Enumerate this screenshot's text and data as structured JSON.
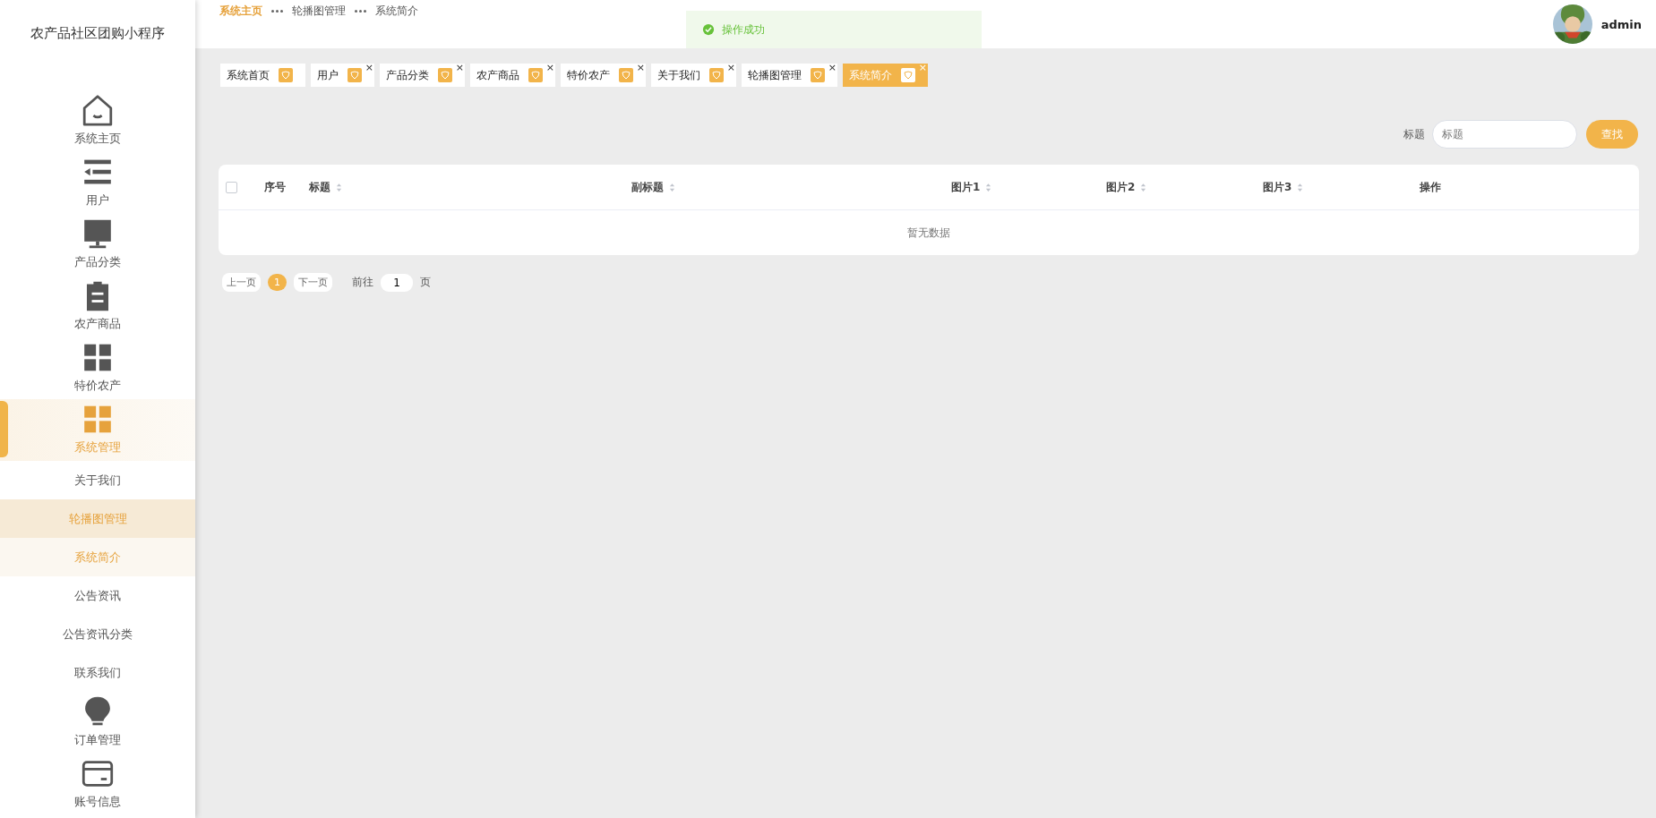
{
  "sidebar": {
    "title": "农产品社区团购小程序",
    "items": [
      {
        "label": "系统主页",
        "kind": "home",
        "selected": false
      },
      {
        "label": "用户",
        "kind": "list",
        "selected": false
      },
      {
        "label": "产品分类",
        "kind": "monitor",
        "selected": false
      },
      {
        "label": "农产商品",
        "kind": "clipboard",
        "selected": false
      },
      {
        "label": "特价农产",
        "kind": "grid",
        "selected": false
      },
      {
        "label": "系统管理",
        "kind": "grid",
        "selected": true,
        "children": [
          {
            "label": "关于我们",
            "selected": false,
            "hovered": false
          },
          {
            "label": "轮播图管理",
            "selected": false,
            "hovered": true
          },
          {
            "label": "系统简介",
            "selected": true,
            "hovered": false
          },
          {
            "label": "公告资讯",
            "selected": false,
            "hovered": false
          },
          {
            "label": "公告资讯分类",
            "selected": false,
            "hovered": false
          },
          {
            "label": "联系我们",
            "selected": false,
            "hovered": false
          }
        ]
      },
      {
        "label": "订单管理",
        "kind": "bulb",
        "selected": false
      },
      {
        "label": "账号信息",
        "kind": "card",
        "selected": false
      }
    ]
  },
  "breadcrumb": [
    {
      "label": "系统主页",
      "link": true
    },
    {
      "label": "轮播图管理",
      "link": false
    },
    {
      "label": "系统简介",
      "link": false
    }
  ],
  "toast": {
    "message": "操作成功",
    "kind": "success"
  },
  "user": {
    "name": "admin"
  },
  "tabs": [
    {
      "label": "系统首页",
      "selected": false
    },
    {
      "label": "用户",
      "selected": false,
      "close": "×"
    },
    {
      "label": "产品分类",
      "selected": false,
      "close": "×"
    },
    {
      "label": "农产商品",
      "selected": false,
      "close": "×"
    },
    {
      "label": "特价农产",
      "selected": false,
      "close": "×"
    },
    {
      "label": "关于我们",
      "selected": false,
      "close": "×"
    },
    {
      "label": "轮播图管理",
      "selected": false,
      "close": "×"
    },
    {
      "label": "系统简介",
      "selected": true,
      "close": "×"
    }
  ],
  "search": {
    "label": "标题",
    "placeholder": "标题",
    "button": "查找"
  },
  "table": {
    "select_all": {
      "checked": false
    },
    "columns": [
      {
        "label": "序号",
        "sortable": false
      },
      {
        "label": "标题",
        "sortable": true
      },
      {
        "label": "副标题",
        "sortable": true
      },
      {
        "label": "图片1",
        "sortable": true
      },
      {
        "label": "图片2",
        "sortable": true
      },
      {
        "label": "图片3",
        "sortable": true
      },
      {
        "label": "操作",
        "sortable": false
      }
    ],
    "empty_text": "暂无数据"
  },
  "pagination": {
    "prev": "上一页",
    "pages": [
      {
        "label": "1",
        "selected": true
      }
    ],
    "next": "下一页",
    "goto_label": "前往",
    "goto_value": "1",
    "unit": "页"
  }
}
